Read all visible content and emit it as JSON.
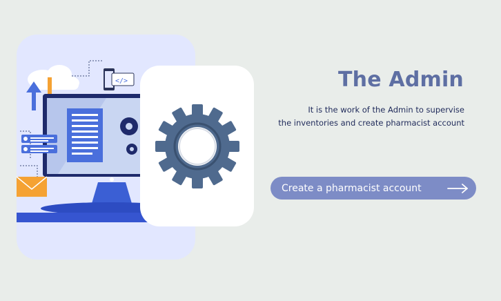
{
  "hero": {
    "title": "The Admin",
    "description_line1": "It is the work of the Admin to supervise",
    "description_line2": "the inventories and create pharmacist account"
  },
  "cta": {
    "label": "Create a pharmacist account",
    "icon": "arrow-right-icon"
  },
  "illustration": {
    "icons": [
      "cloud-icon",
      "upload-arrow-icon",
      "download-arrow-icon",
      "code-tablet-icon",
      "envelope-icon",
      "gear-icon",
      "monitor-icon"
    ]
  },
  "colors": {
    "background": "#e9edea",
    "title": "#5e6fa3",
    "text": "#1f2a5a",
    "button": "#7d8cc6",
    "gear": "#4f6a8e"
  }
}
